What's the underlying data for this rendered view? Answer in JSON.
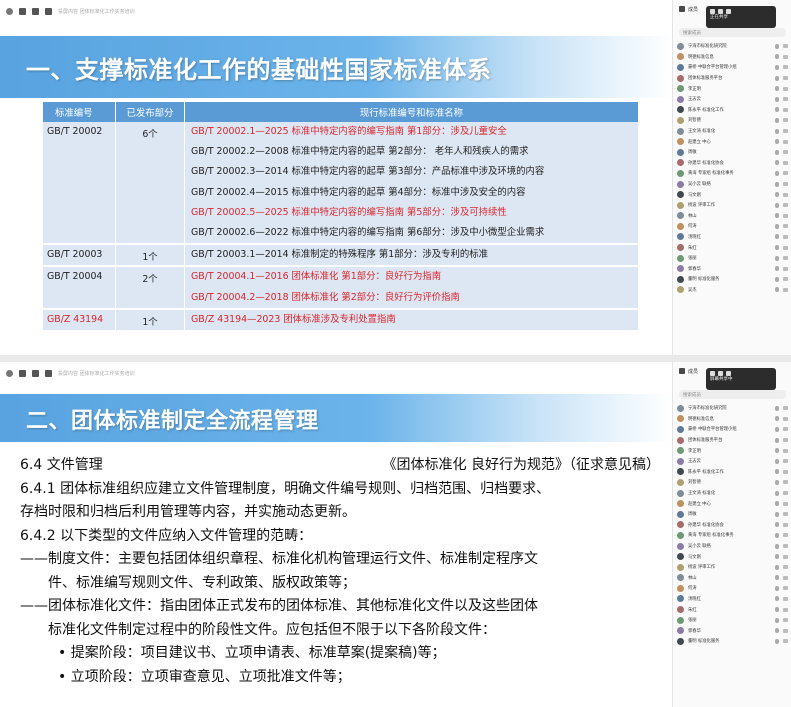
{
  "top": {
    "toolbar_text": "投屏内容 团体标准化工作实务培训",
    "slide_title": "一、支撑标准化工作的基础性国家标准体系",
    "table": {
      "headers": [
        "标准编号",
        "已发布部分",
        "现行标准编号和标准名称"
      ],
      "rows": [
        {
          "code": "GB/T 20002",
          "count": "6个",
          "code_red": false,
          "lines": [
            {
              "text": "GB/T 20002.1—2025 标准中特定内容的编写指南  第1部分：涉及儿童安全",
              "red": true
            },
            {
              "text": "GB/T 20002.2—2008 标准中特定内容的起草  第2部分：  老年人和残疾人的需求",
              "red": false
            },
            {
              "text": "GB/T 20002.3—2014 标准中特定内容的起草  第3部分：产品标准中涉及环境的内容",
              "red": false
            },
            {
              "text": "GB/T 20002.4—2015 标准中特定内容的起草  第4部分：标准中涉及安全的内容",
              "red": false
            },
            {
              "text": "GB/T 20002.5—2025 标准中特定内容的编写指南  第5部分：涉及可持续性",
              "red": true
            },
            {
              "text": "GB/T 20002.6—2022 标准中特定内容的编写指南  第6部分：涉及中小微型企业需求",
              "red": false
            }
          ]
        },
        {
          "code": "GB/T 20003",
          "count": "1个",
          "code_red": false,
          "lines": [
            {
              "text": "GB/T 20003.1—2014 标准制定的特殊程序  第1部分：涉及专利的标准",
              "red": false
            }
          ]
        },
        {
          "code": "GB/T 20004",
          "count": "2个",
          "code_red": false,
          "lines": [
            {
              "text": "GB/T 20004.1—2016 团体标准化  第1部分：良好行为指南",
              "red": true
            },
            {
              "text": "GB/T 20004.2—2018 团体标准化  第2部分：良好行为评价指南",
              "red": true
            }
          ]
        },
        {
          "code": "GB/Z 43194",
          "count": "1个",
          "code_red": true,
          "lines": [
            {
              "text": "GB/Z 43194—2023 团体标准涉及专利处置指南",
              "red": true
            }
          ]
        }
      ]
    }
  },
  "bottom": {
    "toolbar_text": "投屏内容 团体标准化工作实务培训",
    "slide_title": "二、团体标准制定全流程管理",
    "section_heading": "6.4  文件管理",
    "doc_reference": "《团体标准化  良好行为规范》（征求意见稿）",
    "lines": [
      {
        "text": "6.4.1 团体标准组织应建立文件管理制度，明确文件编号规则、归档范围、归档要求、",
        "style": ""
      },
      {
        "text": "存档时限和归档后利用管理等内容，并实施动态更新。",
        "style": ""
      },
      {
        "text": "6.4.2 以下类型的文件应纳入文件管理的范畴：",
        "style": ""
      },
      {
        "text": "——制度文件：主要包括团体组织章程、标准化机构管理运行文件、标准制定程序文",
        "style": ""
      },
      {
        "text": "件、标准编写规则文件、专利政策、版权政策等；",
        "style": "ind1"
      },
      {
        "text": "——团体标准化文件：指由团体正式发布的团体标准、其他标准化文件以及这些团体",
        "style": ""
      },
      {
        "text": "标准化文件制定过程中的阶段性文件。应包括但不限于以下各阶段文件：",
        "style": "ind1"
      },
      {
        "text": "• 提案阶段：项目建议书、立项申请表、标准草案(提案稿)等；",
        "style": "bullet"
      },
      {
        "text": "• 立项阶段：立项审查意见、立项批准文件等；",
        "style": "bullet"
      }
    ]
  },
  "side": {
    "header": "成员",
    "popup_line1": "正在共享",
    "popup_line2": "屏幕共享中",
    "search_placeholder": "搜索成员",
    "members": [
      "宁海市标准化研究院",
      "明德标准信息",
      "豪桥 中联合平台管理小组",
      "团体标准服务平台",
      "李正明",
      "王志云",
      "陈永平 标准化工作",
      "刘智德",
      "王文涛 标准化",
      "赵建立 中心",
      "周敏",
      "孙建华 标准化协会",
      "黄海 专家组 标准化事务",
      "吴小云 联络",
      "马文刚",
      "杨波 评审工作",
      "林山",
      "何涛",
      "汤晓红",
      "朱红",
      "张丽",
      "郭春华",
      "董明 标准化服务",
      "吴杰"
    ]
  }
}
